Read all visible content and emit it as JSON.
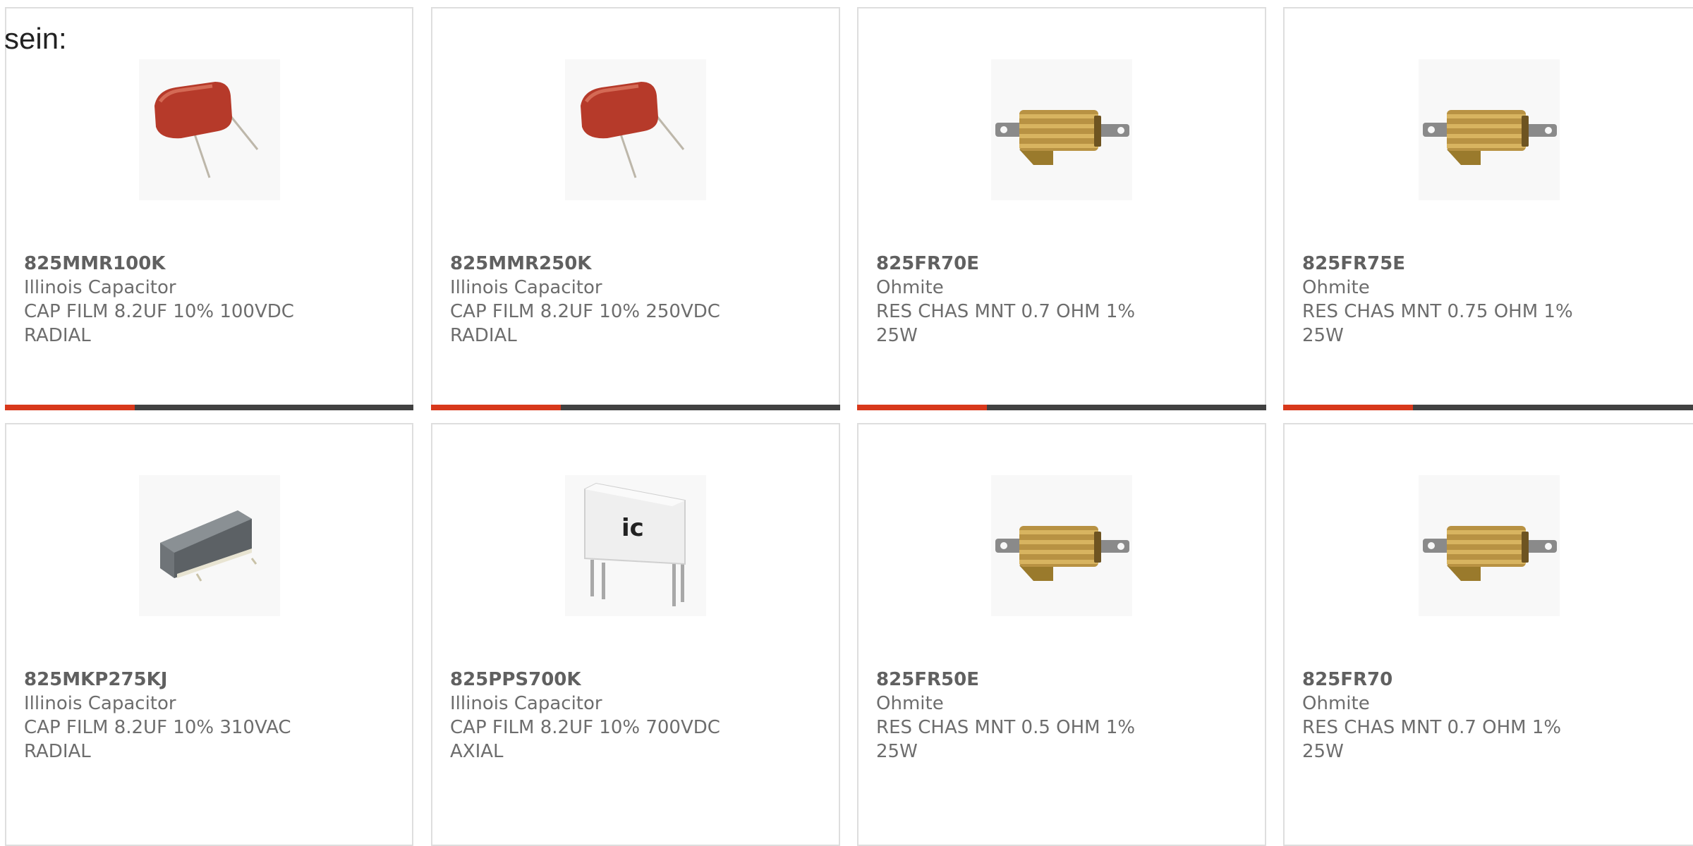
{
  "intro_text": "sein:",
  "colors": {
    "accent": "#d8381b",
    "bar": "#414141",
    "border": "#dedede",
    "text": "#6d6d6d"
  },
  "products": [
    {
      "part_number": "825MMR100K",
      "manufacturer": "Illinois Capacitor",
      "desc_line1": "CAP FILM 8.2UF 10% 100VDC",
      "desc_line2": "RADIAL",
      "image": "film-capacitor-red"
    },
    {
      "part_number": "825MMR250K",
      "manufacturer": "Illinois Capacitor",
      "desc_line1": "CAP FILM 8.2UF 10% 250VDC",
      "desc_line2": "RADIAL",
      "image": "film-capacitor-red"
    },
    {
      "part_number": "825FR70E",
      "manufacturer": "Ohmite",
      "desc_line1": "RES CHAS MNT 0.7 OHM 1%",
      "desc_line2": "25W",
      "image": "chassis-resistor-gold"
    },
    {
      "part_number": "825FR75E",
      "manufacturer": "Ohmite",
      "desc_line1": "RES CHAS MNT 0.75 OHM 1%",
      "desc_line2": "25W",
      "image": "chassis-resistor-gold"
    },
    {
      "part_number": "825MKP275KJ",
      "manufacturer": "Illinois Capacitor",
      "desc_line1": "CAP FILM 8.2UF 10% 310VAC",
      "desc_line2": "RADIAL",
      "image": "box-capacitor-gray"
    },
    {
      "part_number": "825PPS700K",
      "manufacturer": "Illinois Capacitor",
      "desc_line1": "CAP FILM 8.2UF 10% 700VDC",
      "desc_line2": "AXIAL",
      "image": "box-capacitor-white"
    },
    {
      "part_number": "825FR50E",
      "manufacturer": "Ohmite",
      "desc_line1": "RES CHAS MNT 0.5 OHM 1%",
      "desc_line2": "25W",
      "image": "chassis-resistor-gold"
    },
    {
      "part_number": "825FR70",
      "manufacturer": "Ohmite",
      "desc_line1": "RES CHAS MNT 0.7 OHM 1%",
      "desc_line2": "25W",
      "image": "chassis-resistor-gold"
    }
  ]
}
